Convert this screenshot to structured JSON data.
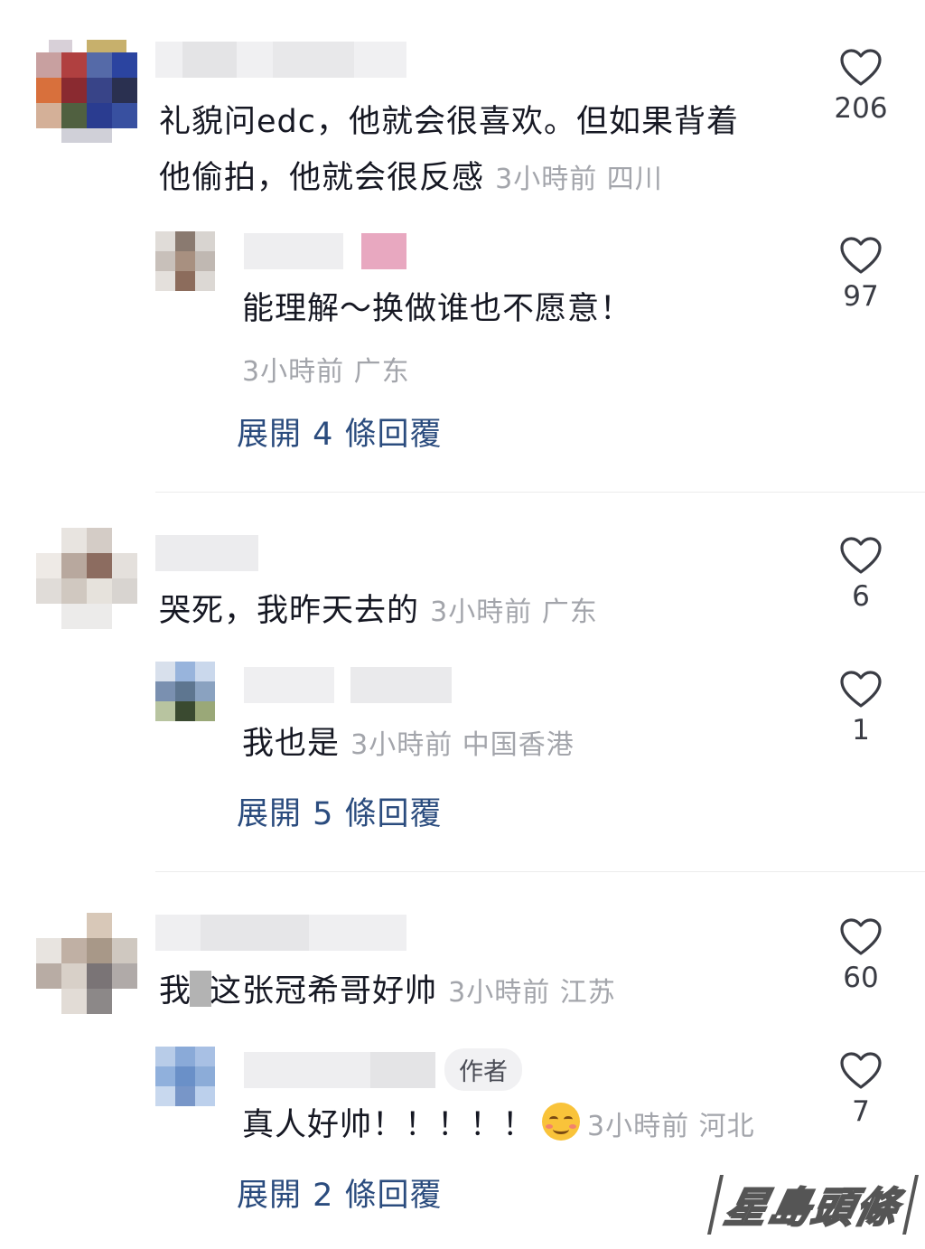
{
  "comments": [
    {
      "text_line1": "礼貌问edc，他就会很喜欢。但如果背着",
      "text_line2": "他偷拍，他就会很反感",
      "meta": "3小時前 四川",
      "likes": "206",
      "reply": {
        "text": "能理解～换做谁也不愿意！",
        "meta": "3小時前 广东",
        "likes": "97"
      },
      "expand": "展開 4 條回覆"
    },
    {
      "text": "哭死，我昨天去的",
      "meta": "3小時前 广东",
      "likes": "6",
      "reply": {
        "text": "我也是",
        "meta": "3小時前 中国香港",
        "likes": "1"
      },
      "expand": "展開 5 條回覆"
    },
    {
      "text_before": "我",
      "text_after": "这张冠希哥好帅",
      "meta": "3小時前 江苏",
      "likes": "60",
      "reply": {
        "author_badge": "作者",
        "text": "真人好帅！！！！！",
        "emoji": "smiling-face-emoji",
        "meta": "3小時前 河北",
        "likes": "7"
      },
      "expand": "展開 2 條回覆"
    }
  ],
  "watermark": "星島頭條",
  "colors": {
    "text": "#161823",
    "meta": "#a3a5ab",
    "link": "#2b4c7e",
    "divider": "#ececec"
  },
  "icons": [
    "heart-outline-icon"
  ]
}
